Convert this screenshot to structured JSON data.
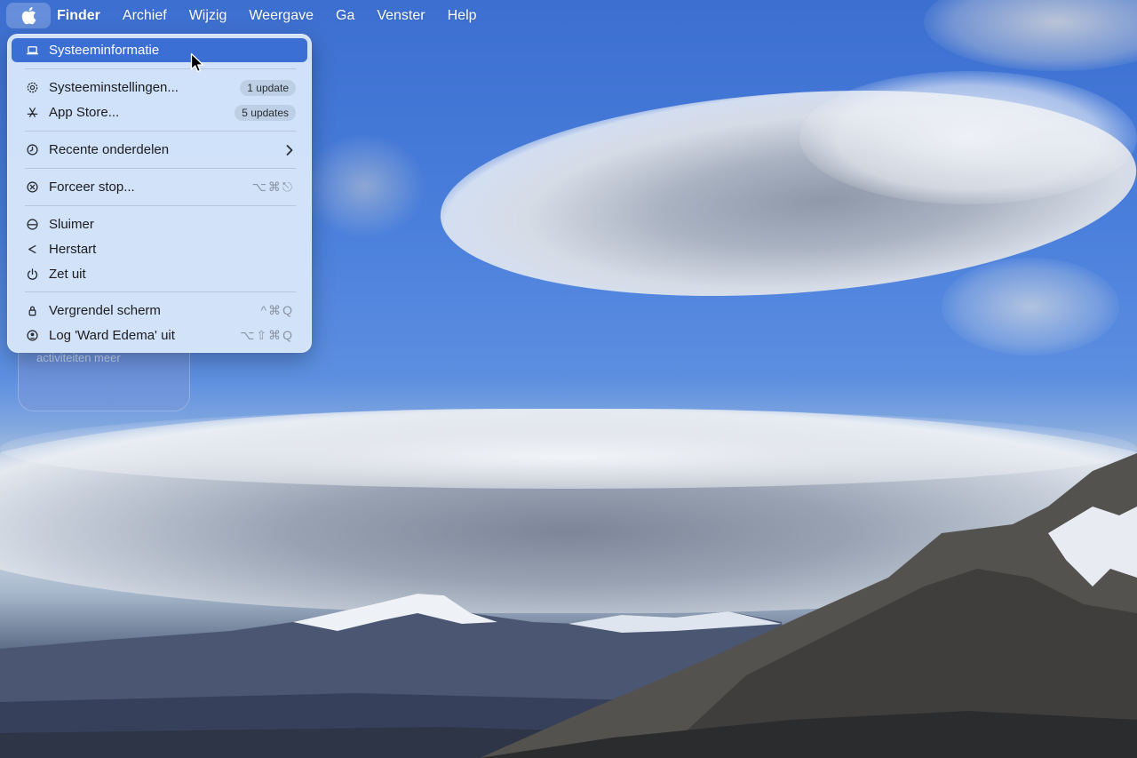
{
  "menubar": {
    "apple_icon": "apple-logo-icon",
    "menus": [
      "Finder",
      "Archief",
      "Wijzig",
      "Weergave",
      "Ga",
      "Venster",
      "Help"
    ]
  },
  "apple_menu": {
    "items": {
      "about": {
        "label": "Systeeminformatie",
        "icon": "laptop-icon"
      },
      "settings": {
        "label": "Systeeminstellingen...",
        "badge": "1 update",
        "icon": "gear-icon"
      },
      "appstore": {
        "label": "App Store...",
        "badge": "5 updates",
        "icon": "app-store-icon"
      },
      "recent": {
        "label": "Recente onderdelen",
        "icon": "clock-icon",
        "submenu_icon": "chevron-right-icon"
      },
      "force_quit": {
        "label": "Forceer stop...",
        "shortcut": "⌥⌘⎋",
        "icon": "x-circle-icon"
      },
      "sleep": {
        "label": "Sluimer",
        "icon": "moon-circle-icon"
      },
      "restart": {
        "label": "Herstart",
        "icon": "restart-icon"
      },
      "shutdown": {
        "label": "Zet uit",
        "icon": "power-icon"
      },
      "lock": {
        "label": "Vergrendel scherm",
        "shortcut": "^⌘Q",
        "icon": "lock-icon"
      },
      "logout": {
        "label": "Log 'Ward Edema' uit",
        "shortcut": "⌥⇧⌘Q",
        "icon": "user-circle-icon"
      }
    }
  },
  "widget": {
    "text": "activiteiten meer"
  },
  "colors": {
    "highlight": "#3b6fd4",
    "menu_bg": "#d6e6fa"
  }
}
